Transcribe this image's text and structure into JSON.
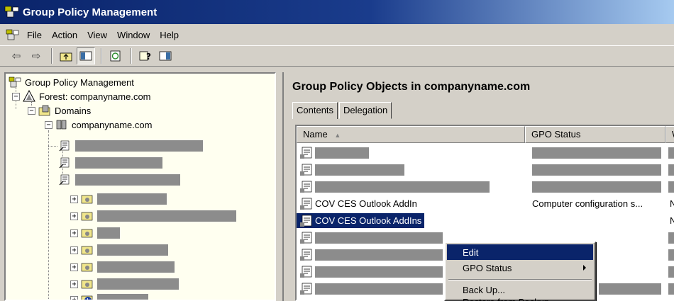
{
  "window": {
    "title": "Group Policy Management"
  },
  "menu": {
    "file": "File",
    "action": "Action",
    "view": "View",
    "window": "Window",
    "help": "Help"
  },
  "tree": {
    "root": "Group Policy Management",
    "forest": "Forest: companyname.com",
    "domains": "Domains",
    "domain": "companyname.com"
  },
  "main": {
    "heading": "Group Policy Objects in companyname.com",
    "tabs": [
      "Contents",
      "Delegation"
    ],
    "columns": [
      "Name",
      "GPO Status",
      "W"
    ],
    "rows": [
      {
        "name": "",
        "status": ""
      },
      {
        "name": "",
        "status": ""
      },
      {
        "name": "",
        "status": ""
      },
      {
        "name": "COV CES Outlook AddIn",
        "status": "Computer configuration s...",
        "extra": "N"
      },
      {
        "name": "COV CES Outlook AddIns",
        "status": "",
        "extra": "N"
      }
    ]
  },
  "context_menu": {
    "items": [
      "Edit",
      "GPO Status",
      "Back Up...",
      "Restore from Backup..."
    ]
  }
}
